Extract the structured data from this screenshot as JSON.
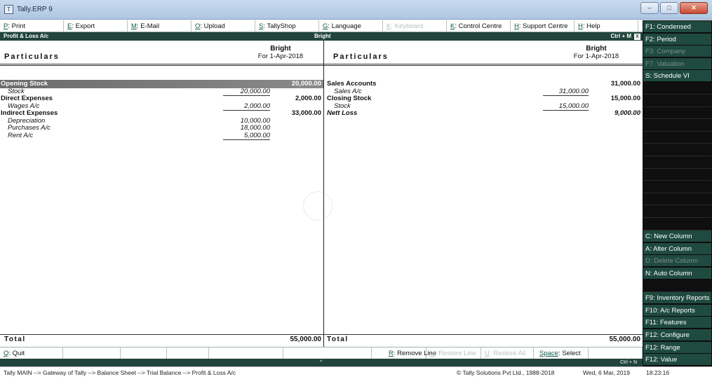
{
  "window": {
    "title": "Tally.ERP 9",
    "app_icon": "tally-icon"
  },
  "top_menu": [
    {
      "key": "P",
      "label": ": Print",
      "enabled": true
    },
    {
      "key": "E",
      "label": ": Export",
      "enabled": true
    },
    {
      "key": "M",
      "label": ": E-Mail",
      "enabled": true
    },
    {
      "key": "O",
      "label": ": Upload",
      "enabled": true
    },
    {
      "key": "S",
      "label": ": TallyShop",
      "enabled": true
    },
    {
      "key": "G",
      "label": ": Language",
      "enabled": true
    },
    {
      "key": "K",
      "label": ": Keyboard",
      "enabled": false
    },
    {
      "key": "K",
      "label": ": Control Centre",
      "enabled": true
    },
    {
      "key": "H",
      "label": ": Support Centre",
      "enabled": true
    },
    {
      "key": "H",
      "label": ": Help",
      "enabled": true
    }
  ],
  "header_strip": {
    "left": "Profit & Loss A/c",
    "center": "Bright",
    "right": "Ctrl + M",
    "close": "X"
  },
  "report": {
    "left": {
      "particulars_label": "Particulars",
      "company": "Bright",
      "period": "For 1-Apr-2018",
      "rows": [
        {
          "type": "group",
          "label": "Opening Stock",
          "total": "20,000.00",
          "highlight": true
        },
        {
          "type": "sub",
          "label": "Stock",
          "amount": "20,000.00",
          "underline": true
        },
        {
          "type": "group",
          "label": "Direct Expenses",
          "total": "2,000.00"
        },
        {
          "type": "sub",
          "label": "Wages A/c",
          "amount": "2,000.00",
          "underline": true
        },
        {
          "type": "group",
          "label": "Indirect Expenses",
          "total": "33,000.00"
        },
        {
          "type": "sub",
          "label": "Depreciation",
          "amount": "10,000.00"
        },
        {
          "type": "sub",
          "label": "Purchases A/c",
          "amount": "18,000.00"
        },
        {
          "type": "sub",
          "label": "Rent A/c",
          "amount": "5,000.00",
          "underline": true
        }
      ],
      "total_label": "Total",
      "total_amount": "55,000.00"
    },
    "right": {
      "particulars_label": "Particulars",
      "company": "Bright",
      "period": "For 1-Apr-2018",
      "rows": [
        {
          "type": "group",
          "label": "Sales Accounts",
          "total": "31,000.00"
        },
        {
          "type": "sub",
          "label": "Sales A/c",
          "amount": "31,000.00",
          "underline": true
        },
        {
          "type": "group",
          "label": "Closing Stock",
          "total": "15,000.00"
        },
        {
          "type": "sub",
          "label": "Stock",
          "amount": "15,000.00",
          "underline": true
        },
        {
          "type": "group-italic",
          "label": "Nett Loss",
          "total": "9,000.00"
        }
      ],
      "total_label": "Total",
      "total_amount": "55,000.00"
    }
  },
  "bottom_bar": [
    {
      "key": "Q",
      "label": ": Quit",
      "enabled": true
    },
    {
      "key": "",
      "label": "",
      "enabled": true
    },
    {
      "key": "",
      "label": "",
      "enabled": true
    },
    {
      "key": "",
      "label": "",
      "enabled": true
    },
    {
      "key": "",
      "label": "",
      "enabled": true
    },
    {
      "key": "",
      "label": "",
      "enabled": true
    },
    {
      "key": "R",
      "label": ": Remove Line",
      "enabled": true
    },
    {
      "key": "U",
      "label": ": Restore Line",
      "enabled": false
    },
    {
      "key": "U",
      "label": ": Restore All",
      "enabled": false
    },
    {
      "key": "Space",
      "label": ": Select",
      "enabled": true
    },
    {
      "key": "",
      "label": "",
      "enabled": true
    }
  ],
  "ctrl_strip": {
    "up_arrow": "^",
    "right": "Ctrl + N"
  },
  "status_bar": {
    "path": "Tally MAIN --> Gateway of Tally --> Balance Sheet --> Trial Balance --> Profit & Loss A/c",
    "copyright": "© Tally Solutions Pvt Ltd., 1988-2018",
    "date": "Wed, 6 Mar, 2019",
    "time": "18:23:16"
  },
  "right_panel": [
    {
      "key": "F1",
      "label": ": Condensed",
      "enabled": true
    },
    {
      "key": "F2",
      "label": ": Period",
      "enabled": true
    },
    {
      "key": "F3",
      "label": ": Company",
      "enabled": false
    },
    {
      "key": "F7",
      "label": ": Valuation",
      "enabled": false
    },
    {
      "key": "S",
      "label": ": Schedule VI",
      "enabled": true
    },
    {
      "key": "",
      "label": "",
      "enabled": true
    },
    {
      "key": "",
      "label": "",
      "enabled": true
    },
    {
      "key": "",
      "label": "",
      "enabled": true
    },
    {
      "key": "",
      "label": "",
      "enabled": true
    },
    {
      "key": "",
      "label": "",
      "enabled": true
    },
    {
      "key": "",
      "label": "",
      "enabled": true
    },
    {
      "key": "",
      "label": "",
      "enabled": true
    },
    {
      "key": "",
      "label": "",
      "enabled": true
    },
    {
      "key": "",
      "label": "",
      "enabled": true
    },
    {
      "key": "",
      "label": "",
      "enabled": true
    },
    {
      "key": "",
      "label": "",
      "enabled": true
    },
    {
      "key": "",
      "label": "",
      "enabled": true
    },
    {
      "key": "C",
      "label": ": New Column",
      "enabled": true
    },
    {
      "key": "A",
      "label": ": Alter Column",
      "enabled": true
    },
    {
      "key": "D",
      "label": ": Delete Column",
      "enabled": false
    },
    {
      "key": "N",
      "label": ": Auto Column",
      "enabled": true
    },
    {
      "key": "",
      "label": "",
      "enabled": true
    },
    {
      "key": "F9",
      "label": ": Inventory Reports",
      "enabled": true
    },
    {
      "key": "F10",
      "label": ": A/c Reports",
      "enabled": true
    },
    {
      "key": "F11",
      "label": ": Features",
      "enabled": true
    },
    {
      "key": "F12",
      "label": ": Configure",
      "enabled": true
    },
    {
      "key": "F12",
      "label": ": Range",
      "enabled": true
    },
    {
      "key": "F12",
      "label": ": Value",
      "enabled": true
    }
  ],
  "colors": {
    "dark_green": "#21443b",
    "button_green": "#1f4a3f",
    "key_color": "#0c5a4a"
  }
}
